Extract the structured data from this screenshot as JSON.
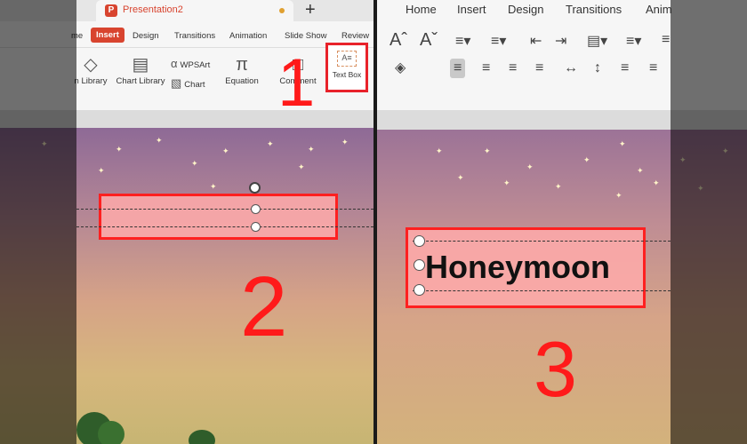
{
  "left": {
    "tab": {
      "app_initial": "P",
      "title": "Presentation2",
      "new_tab": "+"
    },
    "menu": [
      "me",
      "Insert",
      "Design",
      "Transitions",
      "Animation",
      "Slide Show",
      "Review"
    ],
    "ribbon": {
      "icon_library": "n Library",
      "chart_library": "Chart Library",
      "wpsart": "WPSArt",
      "chart": "Chart",
      "equation": "Equation",
      "comment": "Comment",
      "text_box": "Text Box"
    },
    "step_numbers": [
      "1",
      "2"
    ]
  },
  "right": {
    "menu": [
      "Home",
      "Insert",
      "Design",
      "Transitions",
      "Anim"
    ],
    "textbox_content": "Honeymoon",
    "step_number": "3"
  },
  "colors": {
    "highlight_red": "#ff2020",
    "wps_red": "#d8442f"
  }
}
